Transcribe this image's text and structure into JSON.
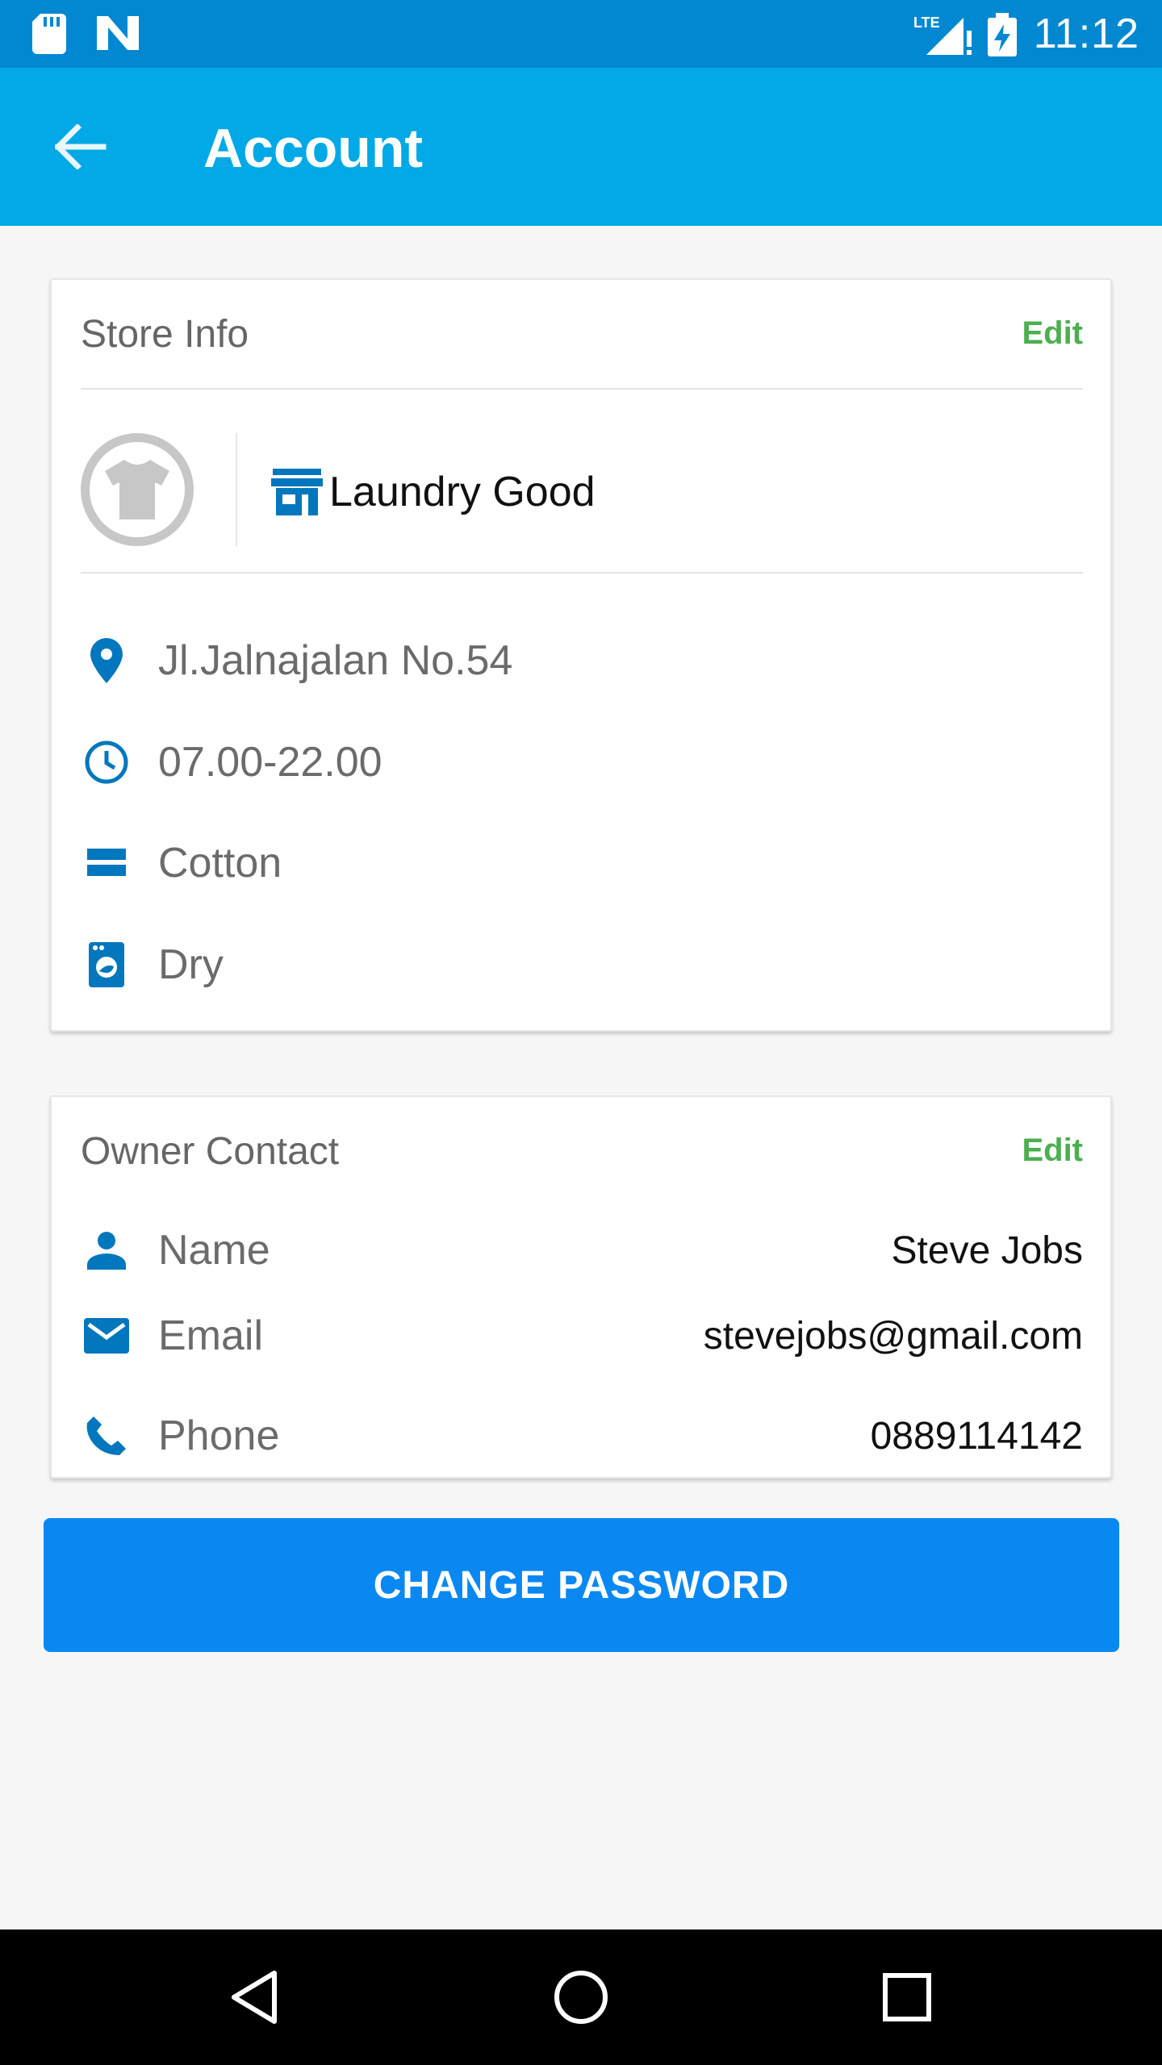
{
  "status_bar": {
    "time": "11:12",
    "network_label": "LTE"
  },
  "app_bar": {
    "title": "Account"
  },
  "store_info": {
    "header": "Store Info",
    "edit_label": "Edit",
    "store_name": "Laundry Good",
    "details": [
      {
        "icon": "location-pin-icon",
        "text": "Jl.Jalnajalan No.54"
      },
      {
        "icon": "clock-icon",
        "text": "07.00-22.00"
      },
      {
        "icon": "fabric-icon",
        "text": "Cotton"
      },
      {
        "icon": "washing-machine-icon",
        "text": "Dry"
      }
    ]
  },
  "owner_contact": {
    "header": "Owner Contact",
    "edit_label": "Edit",
    "rows": [
      {
        "icon": "person-icon",
        "label": "Name",
        "value": "Steve Jobs"
      },
      {
        "icon": "email-icon",
        "label": "Email",
        "value": "stevejobs@gmail.com"
      },
      {
        "icon": "phone-icon",
        "label": "Phone",
        "value": "0889114142"
      }
    ]
  },
  "actions": {
    "change_password_label": "CHANGE PASSWORD"
  },
  "colors": {
    "primary_dark": "#0288d1",
    "primary": "#03a9e6",
    "accent_button": "#0a88f2",
    "edit_green": "#4caf50",
    "icon_blue": "#0277bd"
  }
}
